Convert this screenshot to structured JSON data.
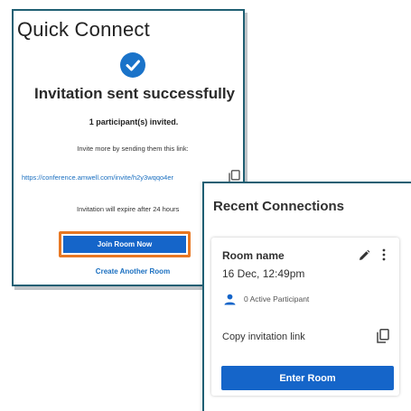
{
  "quick_connect": {
    "title": "Quick Connect",
    "status_icon": "check-circle-icon",
    "heading": "Invitation sent successfully",
    "invited": "1 participant(s) invited.",
    "invite_more": "Invite more by sending them this link:",
    "link": "https://conference.amwell.com/invite/h2y3wqqo4er",
    "expire_note": "Invitation will expire after 24 hours",
    "join_button": "Join Room Now",
    "create_link": "Create Another Room",
    "accent_color": "#1565c9",
    "highlight_color": "#e87722"
  },
  "recent_connections": {
    "title": "Recent Connections",
    "item": {
      "room_name": "Room name",
      "date": "16 Dec, 12:49pm",
      "participants": "0 Active Participant",
      "copy_label": "Copy invitation link",
      "enter_button": "Enter Room"
    }
  }
}
